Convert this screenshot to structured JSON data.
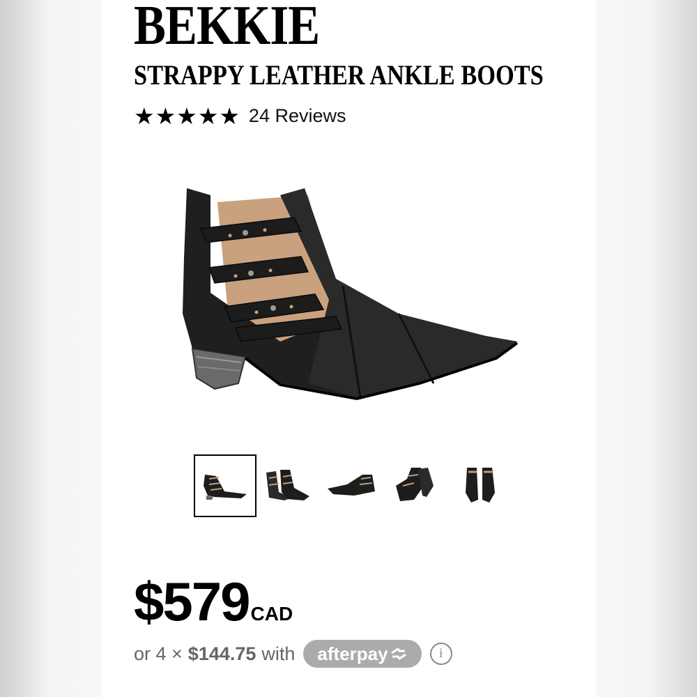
{
  "product": {
    "brand": "BEKKIE",
    "name": "STRAPPY LEATHER ANKLE BOOTS",
    "stars": "★★★★★",
    "rating": 5,
    "reviews_label": "24 Reviews"
  },
  "gallery": {
    "thumbnail_count": 5,
    "selected_index": 0
  },
  "pricing": {
    "price": "$579",
    "currency": "CAD",
    "installment_prefix": "or 4 ×",
    "installment_amount": "$144.75",
    "installment_suffix": "with",
    "provider": "afterpay",
    "info_icon": "ⓘ"
  },
  "colors": {
    "text": "#000000",
    "muted": "#666666",
    "badge": "#ababab"
  }
}
